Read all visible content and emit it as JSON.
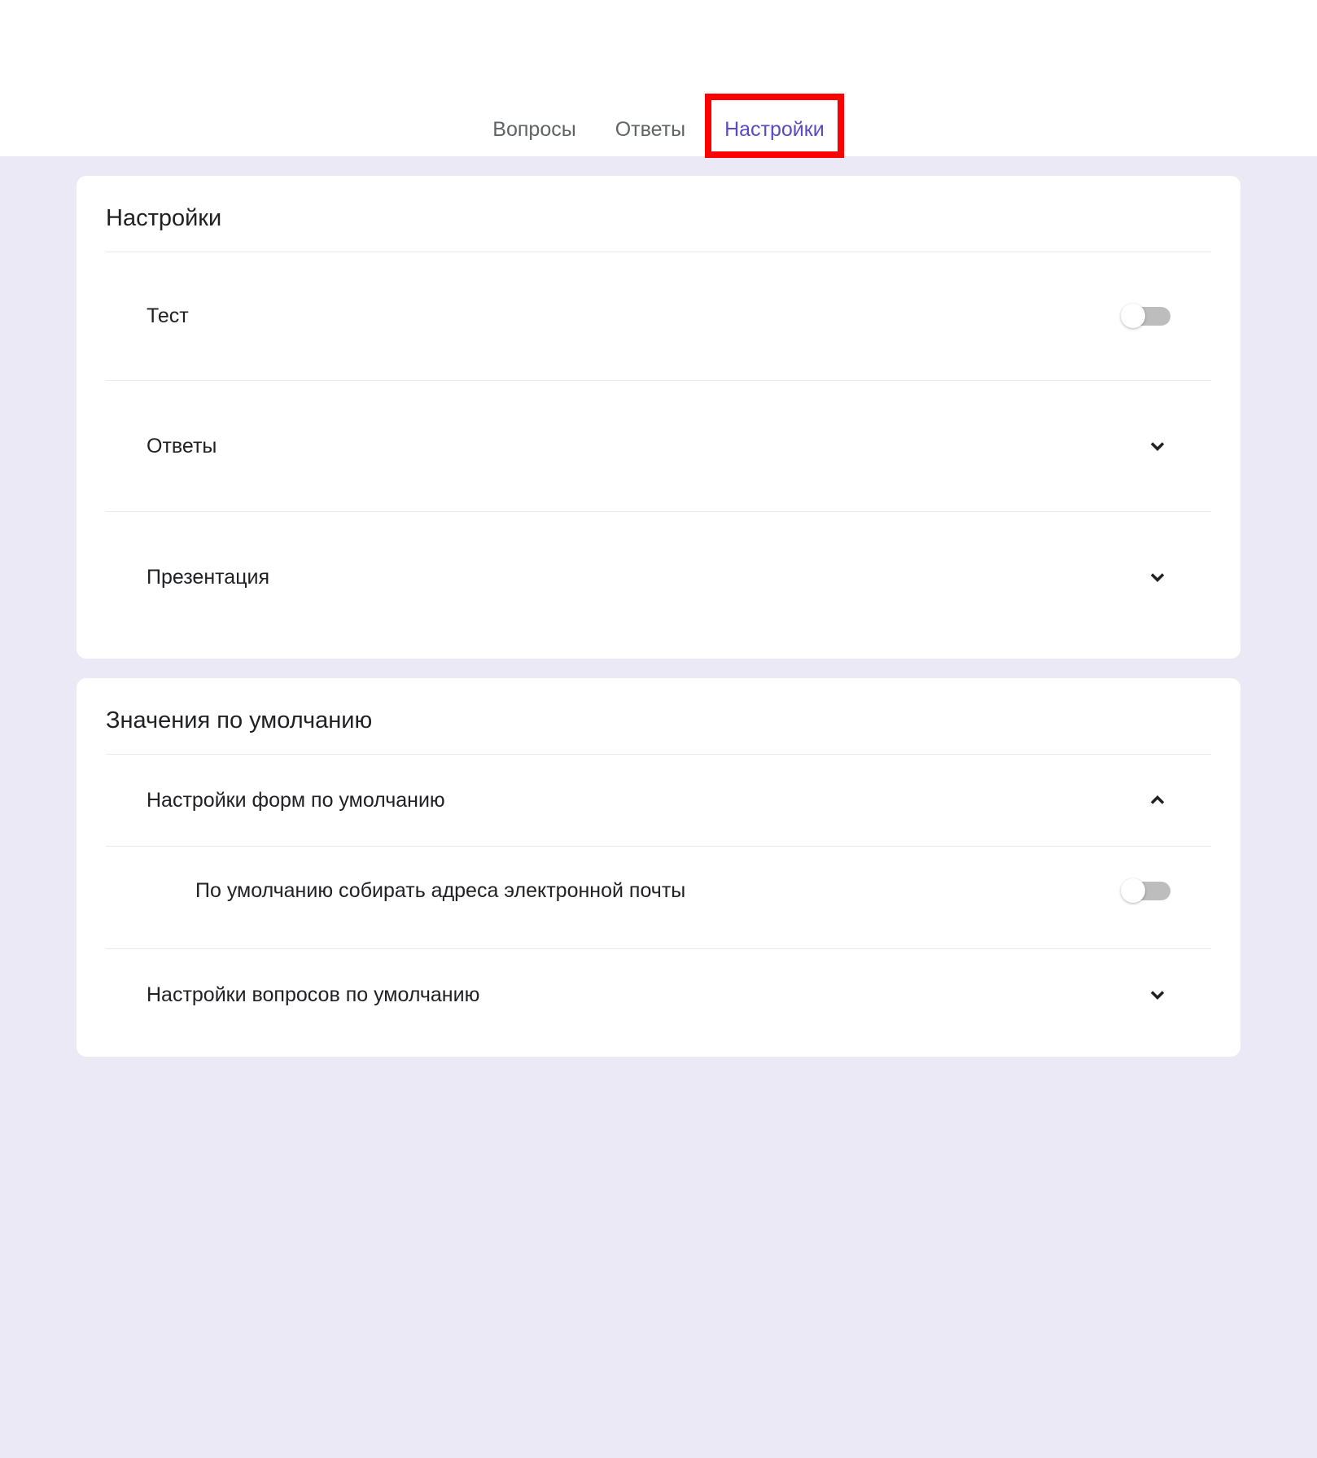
{
  "tabs": {
    "questions": "Вопросы",
    "answers": "Ответы",
    "settings": "Настройки"
  },
  "settingsCard": {
    "title": "Настройки",
    "items": {
      "test": "Тест",
      "answers": "Ответы",
      "presentation": "Презентация"
    }
  },
  "defaultsCard": {
    "title": "Значения по умолчанию",
    "items": {
      "formDefaults": "Настройки форм по умолчанию",
      "collectEmails": "По умолчанию собирать адреса электронной почты",
      "questionDefaults": "Настройки вопросов по умолчанию"
    }
  }
}
